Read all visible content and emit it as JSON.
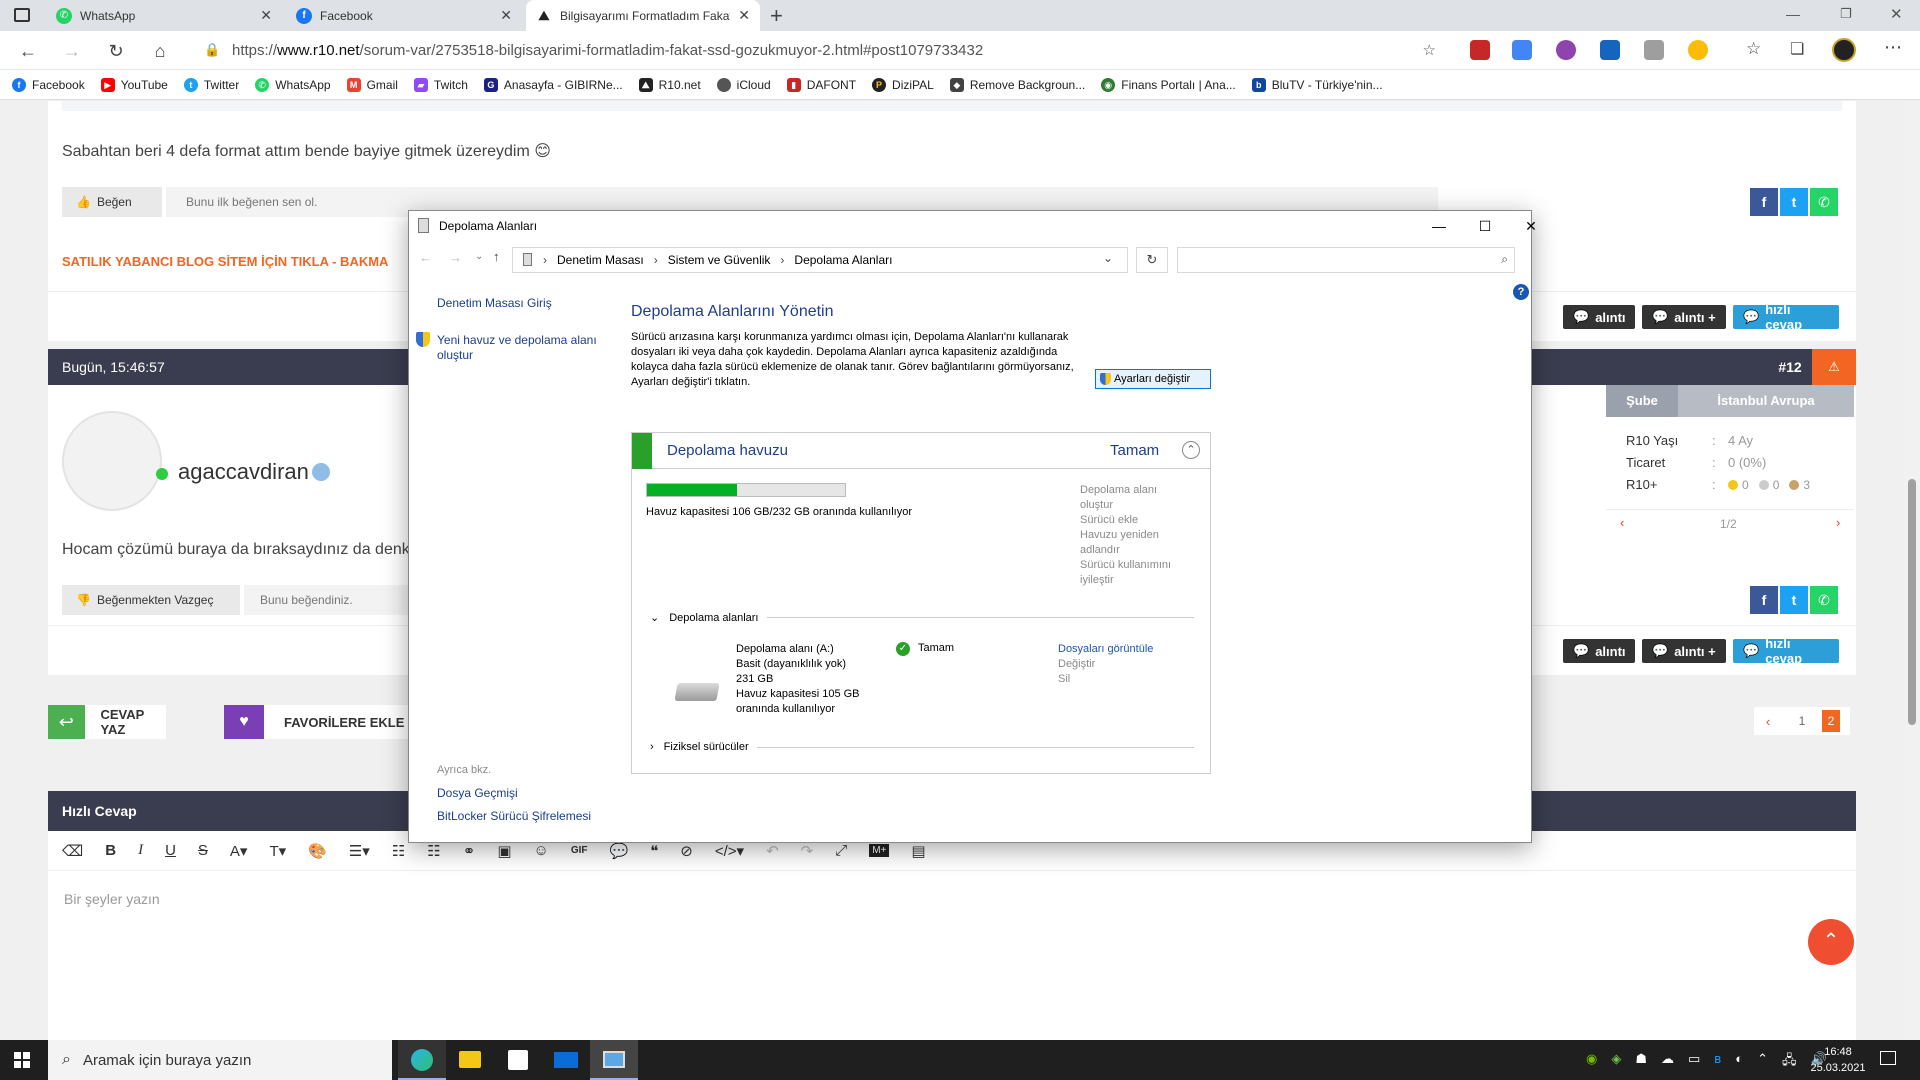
{
  "browser": {
    "tabs": [
      {
        "label": "WhatsApp",
        "icon": "whatsapp-icon",
        "color": "#25d366"
      },
      {
        "label": "Facebook",
        "icon": "facebook-icon",
        "color": "#1877f2"
      },
      {
        "label": "Bilgisayarımı Formatladım Fakat",
        "icon": "r10-icon",
        "color": "#222222"
      }
    ],
    "url_prefix": "https://",
    "url_domain": "www.r10.net",
    "url_path": "/sorum-var/2753518-bilgisayarimi-formatladim-fakat-ssd-gozukmuyor-2.html#post1079733432",
    "bookmarks": [
      "Facebook",
      "YouTube",
      "Twitter",
      "WhatsApp",
      "Gmail",
      "Twitch",
      "Anasayfa - GIBIRNe...",
      "R10.net",
      "iCloud",
      "DAFONT",
      "DiziPAL",
      "Remove Backgroun...",
      "Finans Portalı | Ana...",
      "BluTV - Türkiye'nin..."
    ]
  },
  "forum": {
    "post1_text": "Sabahtan beri 4 defa format attım bende bayiye gitmek üzereydim 😊",
    "like_label": "Beğen",
    "like_note": "Bunu ilk beğenen sen ol.",
    "ad_link": "SATILIK YABANCI BLOG SİTEM İÇİN TIKLA - BAKMA",
    "quote_label": "alıntı",
    "quote_plus_label": "alıntı +",
    "quick_reply_label": "hızlı cevap",
    "post2_time": "Bugün, 15:46:57",
    "post2_number": "#12",
    "username": "agaccavdiran",
    "post2_text": "Hocam çözümü buraya da bıraksaydınız da denk g",
    "unlike_label": "Beğenmekten Vazgeç",
    "unlike_note": "Bunu beğendiniz.",
    "profile": {
      "tab_branch": "Şube",
      "tab_location": "İstanbul Avrupa",
      "age_label": "R10 Yaşı",
      "age_value": "4 Ay",
      "trade_label": "Ticaret",
      "trade_value": "0 (0%)",
      "r10plus_label": "R10+",
      "r10plus_values": [
        "0",
        "0",
        "3"
      ],
      "pager": "1/2"
    },
    "reply_label": "CEVAP YAZ",
    "fav_label": "FAVORİLERE EKLE",
    "pages": [
      "1",
      "2"
    ],
    "quick_reply_header": "Hızlı Cevap",
    "editor_placeholder": "Bir şeyler yazın"
  },
  "dialog": {
    "title": "Depolama Alanları",
    "breadcrumb": [
      "Denetim Masası",
      "Sistem ve Güvenlik",
      "Depolama Alanları"
    ],
    "sidebar_home": "Denetim Masası Giriş",
    "sidebar_create": "Yeni havuz ve depolama alanı oluştur",
    "see_also": "Ayrıca bkz.",
    "file_history": "Dosya Geçmişi",
    "bitlocker": "BitLocker Sürücü Şifrelemesi",
    "heading": "Depolama Alanlarını Yönetin",
    "description": "Sürücü arızasına karşı korunmanıza yardımcı olması için, Depolama Alanları'nı kullanarak dosyaları iki veya daha çok kaydedin. Depolama Alanları ayrıca kapasiteniz azaldığında kolayca daha fazla sürücü eklemenize de olanak tanır. Görev bağlantılarını görmüyorsanız, Ayarları değiştir'i tıklatın.",
    "change_settings": "Ayarları değiştir",
    "pool_title": "Depolama havuzu",
    "pool_status": "Tamam",
    "pool_usage_fraction": 0.456,
    "pool_capacity_text": "Havuz kapasitesi 106 GB/232 GB oranında kullanılıyor",
    "pool_actions": [
      "Depolama alanı oluştur",
      "Sürücü ekle",
      "Havuzu yeniden adlandır",
      "Sürücü kullanımını iyileştir"
    ],
    "spaces_section": "Depolama alanları",
    "space_name": "Depolama alanı (A:)",
    "space_type": "Basit (dayanıklılık yok)",
    "space_size": "231 GB",
    "space_usage": "Havuz kapasitesi 105 GB oranında kullanılıyor",
    "space_status": "Tamam",
    "space_view_files": "Dosyaları görüntüle",
    "space_change": "Değiştir",
    "space_delete": "Sil",
    "physical_section": "Fiziksel sürücüler"
  },
  "taskbar": {
    "search_placeholder": "Aramak için buraya yazın",
    "time": "16:48",
    "date": "25.03.2021"
  }
}
